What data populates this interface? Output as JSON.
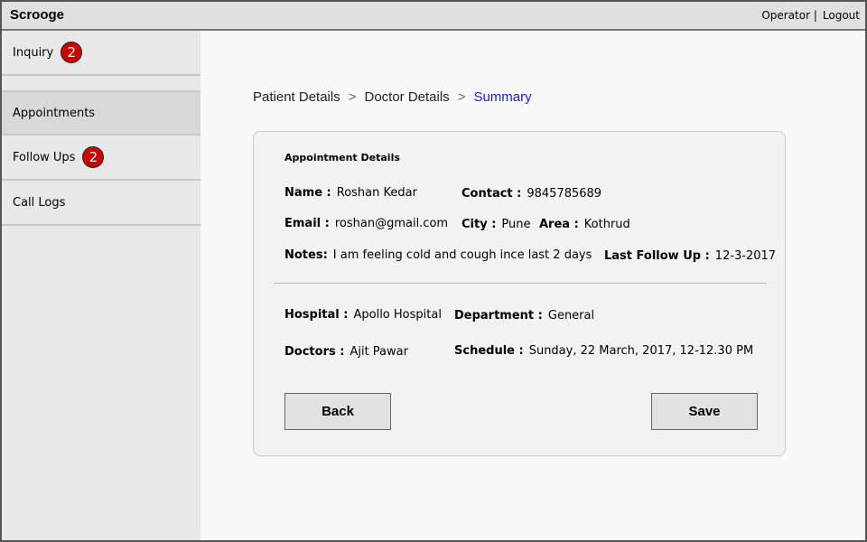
{
  "app": {
    "title": "Scrooge"
  },
  "top_links": {
    "operator": "Operator |",
    "logout": "Logout"
  },
  "sidebar": {
    "items": [
      {
        "label": "Inquiry",
        "badge": "2"
      },
      {
        "label": "Appointments"
      },
      {
        "label": "Follow Ups",
        "badge": "2"
      },
      {
        "label": "Call Logs"
      }
    ]
  },
  "breadcrumb": {
    "step1": "Patient Details",
    "step2": "Doctor Details",
    "step3": "Summary",
    "separator": ">"
  },
  "details": {
    "title": "Appointment Details",
    "name_label": "Name :",
    "name_value": "Roshan Kedar",
    "contact_label": "Contact :",
    "contact_value": "9845785689",
    "email_label": "Email :",
    "email_value": "roshan@gmail.com",
    "city_label": "City :",
    "city_value": "Pune",
    "area_label": "Area :",
    "area_value": "Kothrud",
    "notes_label": "Notes:",
    "notes_value": "I am feeling cold and cough ince last 2 days",
    "last_follow_label": "Last Follow Up :",
    "last_follow_value": "12-3-2017",
    "hospital_label": "Hospital :",
    "hospital_value": "Apollo Hospital",
    "department_label": "Department :",
    "department_value": "General",
    "doctors_label": "Doctors :",
    "doctors_value": "Ajit Pawar",
    "schedule_label": "Schedule :",
    "schedule_value": "Sunday, 22 March, 2017, 12-12.30 PM"
  },
  "actions": {
    "back": "Back",
    "save": "Save"
  },
  "colors": {
    "badge": "#cc0000",
    "breadcrumb_active": "#1a1ad8"
  }
}
